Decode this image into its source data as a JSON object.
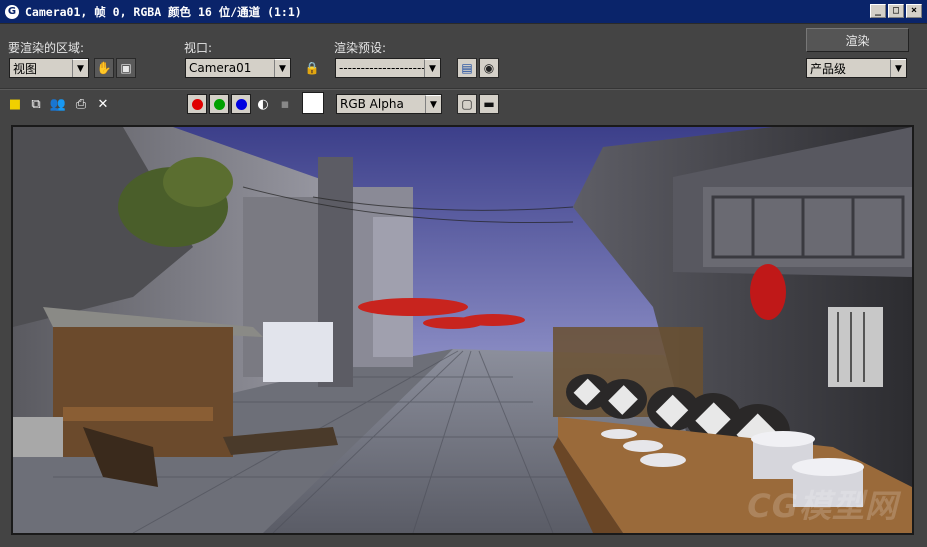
{
  "window": {
    "title": "Camera01, 帧 0, RGBA 颜色 16 位/通道 (1:1)",
    "icon_glyph": "G",
    "buttons": [
      "_",
      "□",
      "×"
    ]
  },
  "render_area": {
    "label": "要渲染的区域:",
    "value": "视图"
  },
  "viewport_select": {
    "label": "视口:",
    "value": "Camera01"
  },
  "render_preset": {
    "label": "渲染预设:",
    "value": "----------------------"
  },
  "render_button": {
    "label": "渲染"
  },
  "production": {
    "value": "产品级"
  },
  "channel": {
    "value": "RGB Alpha"
  },
  "channels": {
    "red": "#e00000",
    "green": "#00a000",
    "blue": "#0000e0"
  },
  "viewport_image": {
    "description_icon": "rendered-street-scene",
    "watermark": "CG模型网"
  },
  "colors": {
    "titlebar": "#0a246a",
    "panel_bg": "#444444"
  }
}
